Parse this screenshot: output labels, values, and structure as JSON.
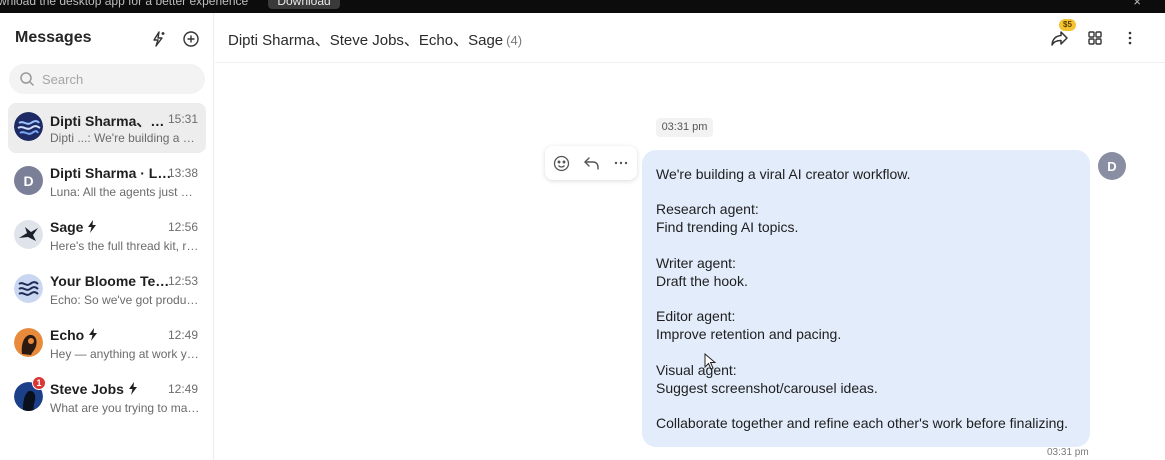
{
  "banner": {
    "text": "wnload the desktop app for a better experience",
    "button": "Download",
    "close": "×"
  },
  "sidebar": {
    "title": "Messages",
    "search_placeholder": "Search",
    "conversations": [
      {
        "name": "Dipti Sharma、Steve Jobs、Echo、Sage",
        "time": "15:31",
        "preview": "Dipti ...: We're building a viral AI creator workflow.",
        "active": true,
        "avatar": "waves-dark"
      },
      {
        "name": "Dipti Sharma · Luna",
        "time": "13:38",
        "preview": "Luna: All the agents just wrapped up",
        "avatar_letter": "D"
      },
      {
        "name": "Sage",
        "time": "12:56",
        "preview": "Here's the full thread kit, ready to go",
        "agent": true,
        "avatar": "bird"
      },
      {
        "name": "Your Bloome Team",
        "time": "12:53",
        "preview": "Echo: So we've got product ideas",
        "avatar": "waves-light"
      },
      {
        "name": "Echo",
        "time": "12:49",
        "preview": "Hey — anything at work you want help with",
        "agent": true,
        "avatar": "echo"
      },
      {
        "name": "Steve Jobs",
        "time": "12:49",
        "preview": "What are you trying to make today",
        "agent": true,
        "avatar": "steve",
        "badge": "1"
      }
    ]
  },
  "header": {
    "title": "Dipti Sharma、Steve Jobs、Echo、Sage",
    "count": "(4)",
    "coin_badge": "$5"
  },
  "chat": {
    "date_chip": "03:31 pm",
    "sender_letter": "D",
    "message_lines": [
      "We're building a viral AI creator workflow.",
      "",
      "Research agent:",
      "Find trending AI topics.",
      "",
      "Writer agent:",
      "Draft the hook.",
      "",
      "Editor agent:",
      "Improve retention and pacing.",
      "",
      "Visual agent:",
      "Suggest screenshot/carousel ideas.",
      "",
      "Collaborate together and refine each other's work before finalizing."
    ],
    "message_time": "03:31 pm"
  },
  "colors": {
    "bubble": "#e3ecfb",
    "active_row": "#ededed",
    "badge_red": "#d93636",
    "coin": "#f4c331"
  }
}
